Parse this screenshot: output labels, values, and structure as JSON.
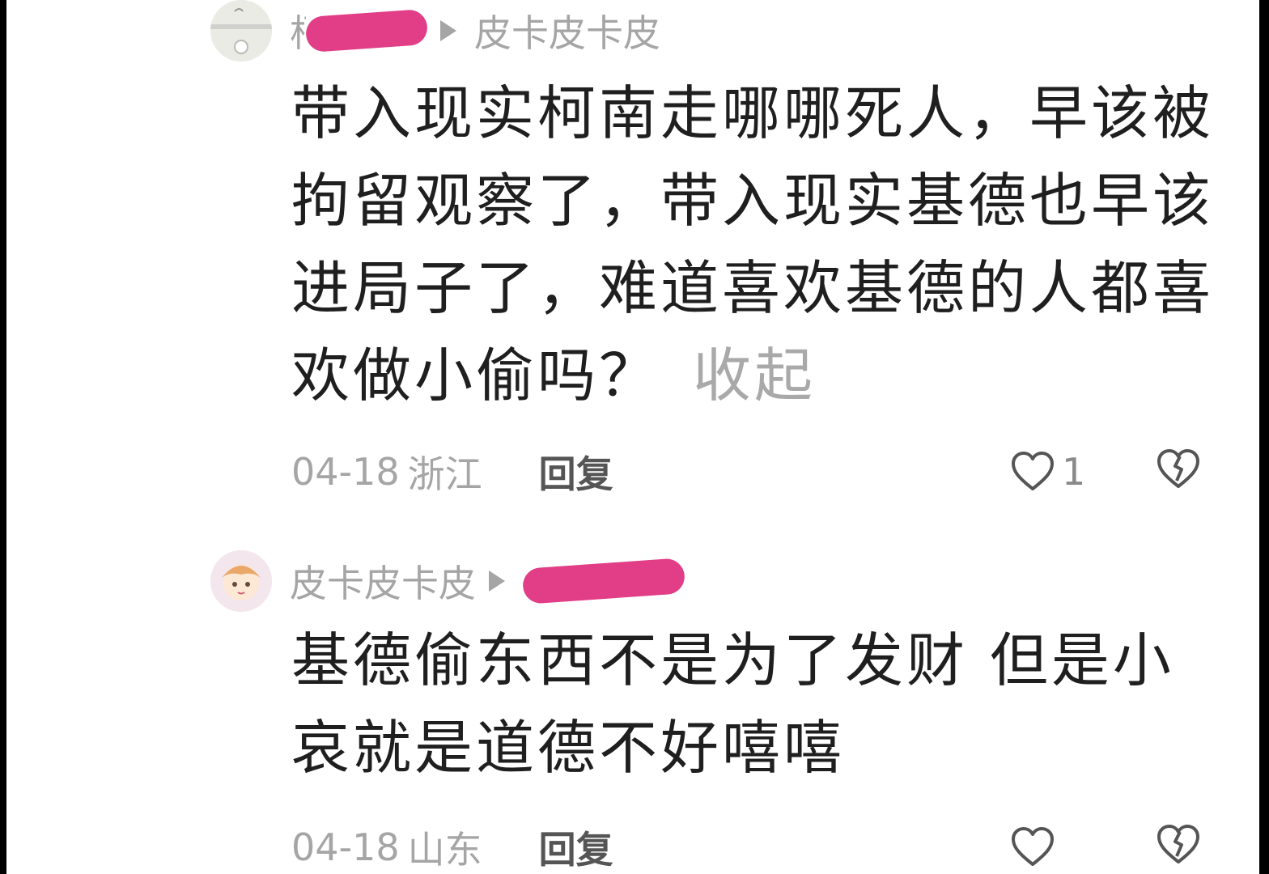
{
  "comments": [
    {
      "author_visible": "柯",
      "reply_to": "皮卡皮卡皮",
      "text": "带入现实柯南走哪哪死人，早该被拘留观察了，带入现实基德也早该进局子了，难道喜欢基德的人都喜欢做小偷吗？",
      "collapse_label": "收起",
      "date": "04-18",
      "location": "浙江",
      "reply_label": "回复",
      "likes": "1"
    },
    {
      "author": "皮卡皮卡皮",
      "text": "基德偷东西不是为了发财 但是小哀就是道德不好嘻嘻",
      "date": "04-18",
      "location": "山东",
      "reply_label": "回复",
      "likes": ""
    }
  ],
  "colors": {
    "redaction": "#e23d87",
    "meta_text": "#a5a5a5",
    "body_text": "#1f1f1f"
  }
}
